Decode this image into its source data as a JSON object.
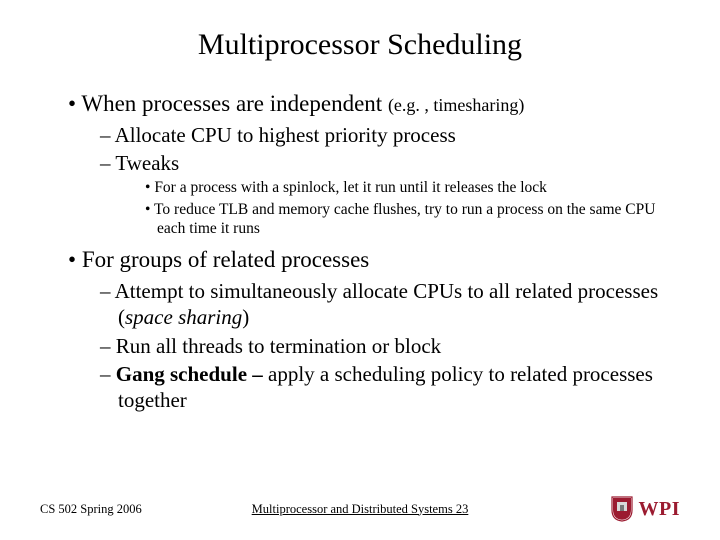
{
  "title": "Multiprocessor Scheduling",
  "b1": {
    "main": "When processes are independent ",
    "paren": "(e.g. , timesharing)"
  },
  "b1a": "Allocate CPU to highest priority process",
  "b1b": "Tweaks",
  "b1b1": "For a process with a spinlock, let it run until it releases the lock",
  "b1b2": "To reduce TLB and memory cache flushes, try to run a process on the same CPU each time it runs",
  "b2": "For groups of related processes",
  "b2a": {
    "pre": "Attempt to simultaneously allocate CPUs to all related processes (",
    "it": "space sharing",
    "post": ")"
  },
  "b2b": "Run all threads to termination or block",
  "b2c": {
    "bold": "Gang schedule – ",
    "rest": "apply a scheduling policy to related processes together"
  },
  "footer": {
    "left": "CS 502 Spring 2006",
    "center": "Multiprocessor and Distributed Systems  23",
    "logo_text": "WPI"
  }
}
